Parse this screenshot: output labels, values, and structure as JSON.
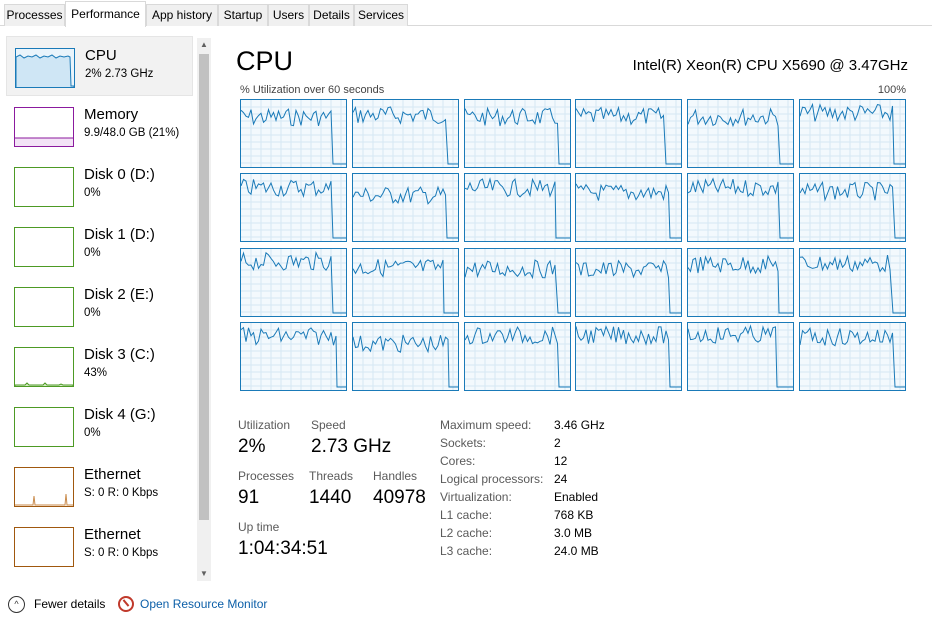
{
  "tabs": [
    {
      "label": "Processes"
    },
    {
      "label": "Performance"
    },
    {
      "label": "App history"
    },
    {
      "label": "Startup"
    },
    {
      "label": "Users"
    },
    {
      "label": "Details"
    },
    {
      "label": "Services"
    }
  ],
  "sidebar": {
    "items": [
      {
        "name": "CPU",
        "value": "2% 2.73 GHz",
        "color": "#1a7ab8"
      },
      {
        "name": "Memory",
        "value": "9.9/48.0 GB (21%)",
        "color": "#8b1a9e"
      },
      {
        "name": "Disk 0 (D:)",
        "value": "0%",
        "color": "#4d9a24"
      },
      {
        "name": "Disk 1 (D:)",
        "value": "0%",
        "color": "#4d9a24"
      },
      {
        "name": "Disk 2 (E:)",
        "value": "0%",
        "color": "#4d9a24"
      },
      {
        "name": "Disk 3 (C:)",
        "value": "43%",
        "color": "#4d9a24"
      },
      {
        "name": "Disk 4 (G:)",
        "value": "0%",
        "color": "#4d9a24"
      },
      {
        "name": "Ethernet",
        "value": "S: 0 R: 0 Kbps",
        "color": "#a0580e"
      },
      {
        "name": "Ethernet",
        "value": "S: 0 R: 0 Kbps",
        "color": "#a0580e"
      }
    ]
  },
  "main": {
    "title": "CPU",
    "cpu_model": "Intel(R) Xeon(R) CPU X5690 @ 3.47GHz",
    "graph_label": "% Utilization over 60 seconds",
    "graph_max": "100%",
    "accent": "#1a7ab8",
    "core_count": 24
  },
  "stats": {
    "utilization_label": "Utilization",
    "utilization": "2%",
    "speed_label": "Speed",
    "speed": "2.73 GHz",
    "processes_label": "Processes",
    "processes": "91",
    "threads_label": "Threads",
    "threads": "1440",
    "handles_label": "Handles",
    "handles": "40978",
    "uptime_label": "Up time",
    "uptime": "1:04:34:51"
  },
  "info": [
    {
      "key": "Maximum speed:",
      "value": "3.46 GHz"
    },
    {
      "key": "Sockets:",
      "value": "2"
    },
    {
      "key": "Cores:",
      "value": "12"
    },
    {
      "key": "Logical processors:",
      "value": "24"
    },
    {
      "key": "Virtualization:",
      "value": "Enabled"
    },
    {
      "key": "L1 cache:",
      "value": "768 KB"
    },
    {
      "key": "L2 cache:",
      "value": "3.0 MB"
    },
    {
      "key": "L3 cache:",
      "value": "24.0 MB"
    }
  ],
  "footer": {
    "fewer_details": "Fewer details",
    "open_monitor": "Open Resource Monitor"
  }
}
